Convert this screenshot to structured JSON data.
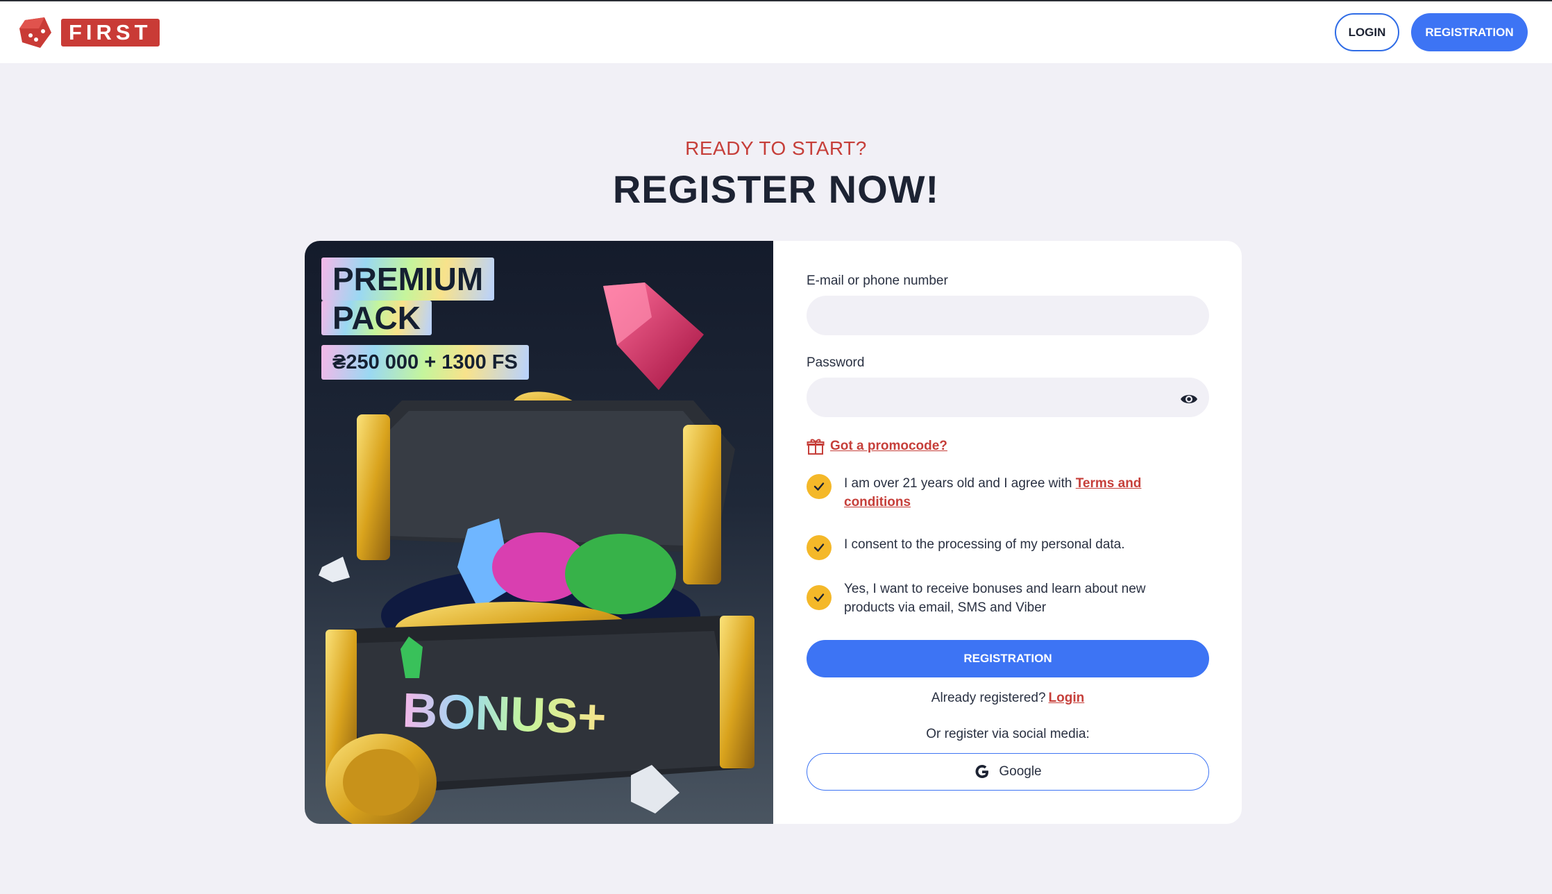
{
  "header": {
    "brand": "FIRST",
    "login_label": "LOGIN",
    "registration_label": "REGISTRATION"
  },
  "hero": {
    "eyebrow": "READY TO START?",
    "title": "REGISTER NOW!"
  },
  "promo": {
    "line1": "PREMIUM",
    "line2": "PACK",
    "offer": "₴250 000 + 1300 FS",
    "chest_text": "BONUS+"
  },
  "form": {
    "email_label": "E-mail or phone number",
    "email_value": "",
    "password_label": "Password",
    "password_value": "",
    "promocode_link": "Got a promocode?",
    "checks": [
      {
        "text": "I am over 21 years old and I agree with ",
        "link": "Terms and conditions",
        "checked": true
      },
      {
        "text": "I consent to the processing of my personal data.",
        "checked": true
      },
      {
        "text": "Yes, I want to receive bonuses and learn about new products via email, SMS and Viber",
        "checked": true
      }
    ],
    "submit_label": "REGISTRATION",
    "already_text": "Already registered?",
    "login_link": "Login",
    "social_label": "Or register via social media:",
    "google_label": "Google"
  },
  "colors": {
    "accent_blue": "#3d74f4",
    "accent_red": "#c63f3a",
    "check_yellow": "#f4b829",
    "page_bg": "#f1f0f6"
  },
  "icons": [
    "dice-logo-icon",
    "eye-icon",
    "gift-icon",
    "check-icon",
    "google-icon"
  ]
}
